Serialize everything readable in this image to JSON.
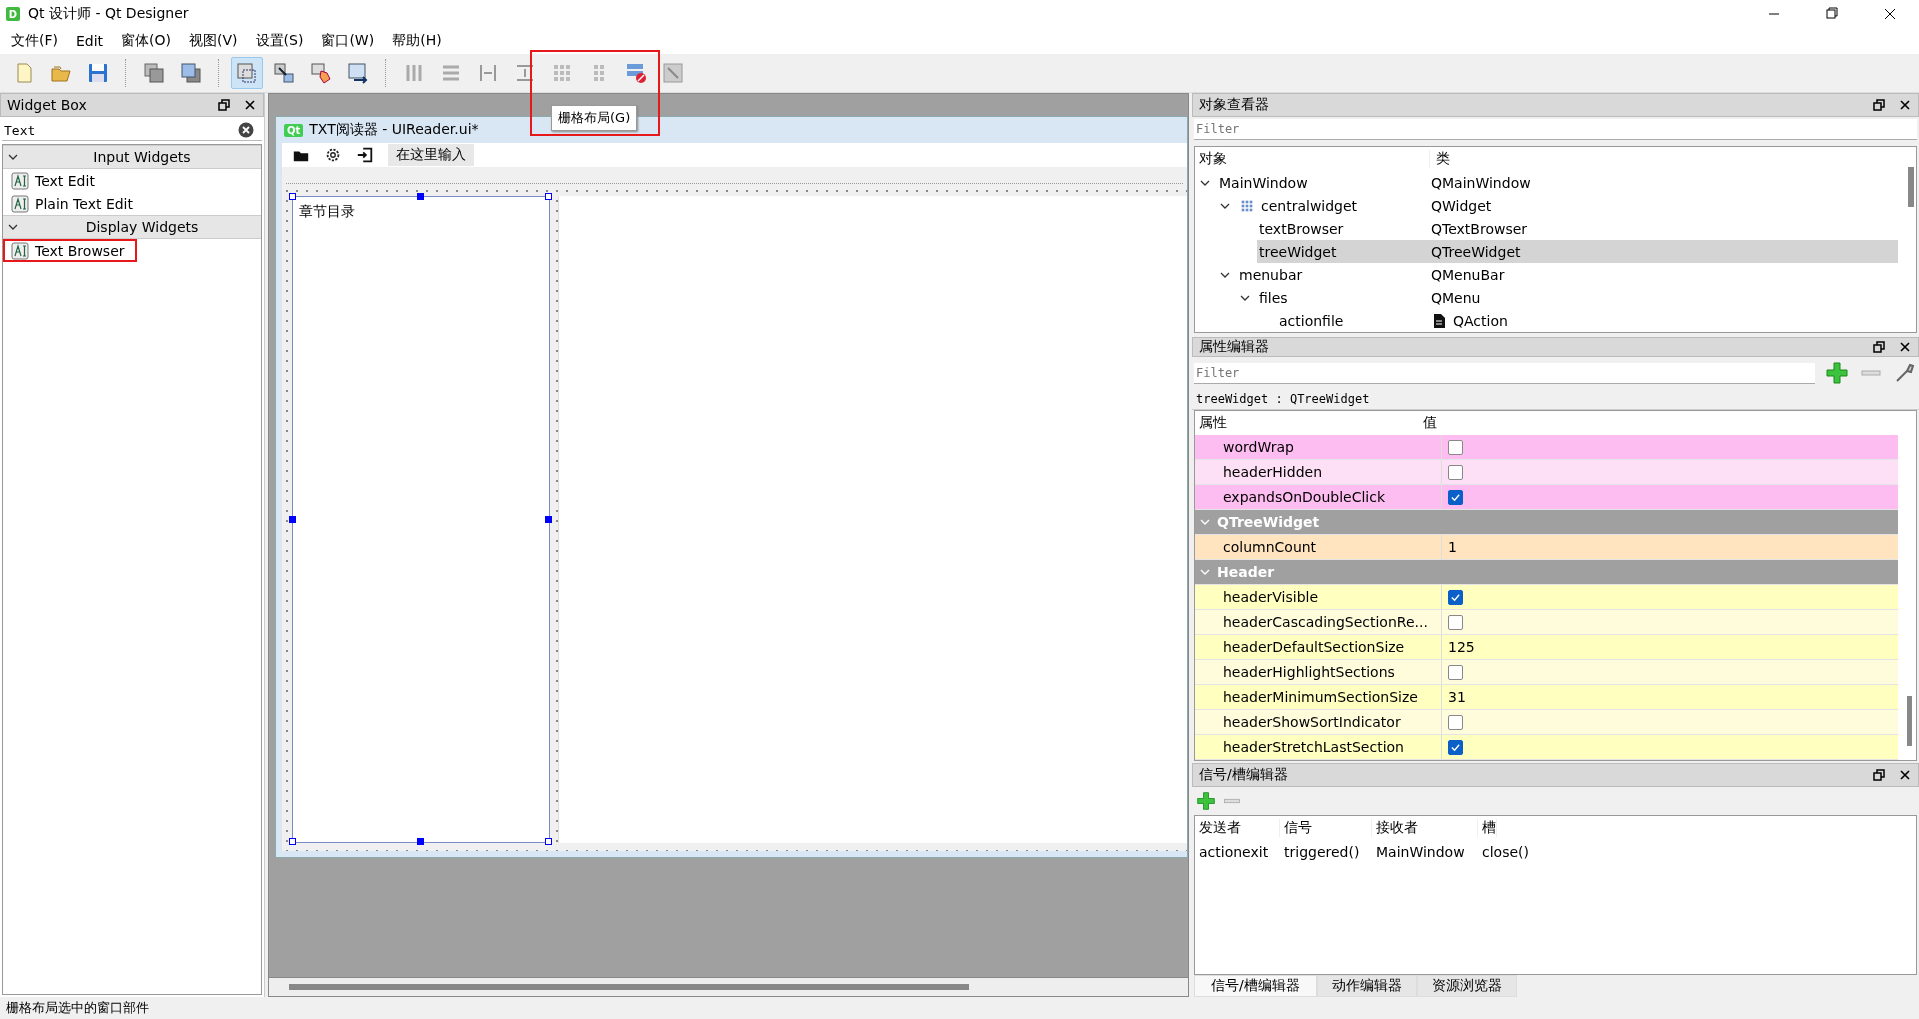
{
  "window": {
    "app_icon": "D",
    "title": "Qt 设计师 - Qt Designer"
  },
  "menu": [
    "文件(F)",
    "Edit",
    "窗体(O)",
    "视图(V)",
    "设置(S)",
    "窗口(W)",
    "帮助(H)"
  ],
  "tooltip": {
    "text": "栅格布局(G)",
    "highlighted": true
  },
  "widget_box": {
    "title": "Widget Box",
    "search": "Text",
    "categories": [
      {
        "name": "Input Widgets",
        "expanded": true,
        "items": [
          {
            "name": "Text Edit",
            "highlighted": false
          },
          {
            "name": "Plain Text Edit",
            "highlighted": false
          }
        ]
      },
      {
        "name": "Display Widgets",
        "expanded": true,
        "items": [
          {
            "name": "Text Browser",
            "highlighted": true
          }
        ]
      }
    ]
  },
  "form": {
    "logo": "Qt",
    "title": "TXT阅读器 - UIReader.ui*",
    "menu_placeholder": "在这里输入",
    "tree_header": "章节目录",
    "tree_selected": true
  },
  "object_inspector": {
    "title": "对象查看器",
    "filter_placeholder": "Filter",
    "columns": [
      "对象",
      "类"
    ],
    "tree": [
      {
        "name": "MainWindow",
        "class": "QMainWindow",
        "expanded": true,
        "selected": false,
        "children": [
          {
            "kind": "layout",
            "name": "centralwidget",
            "class": "QWidget",
            "expanded": true,
            "selected": false,
            "children": [
              {
                "name": "textBrowser",
                "class": "QTextBrowser",
                "selected": false
              },
              {
                "name": "treeWidget",
                "class": "QTreeWidget",
                "selected": true
              }
            ]
          },
          {
            "name": "menubar",
            "class": "QMenuBar",
            "expanded": true,
            "selected": false,
            "children": [
              {
                "name": "files",
                "class": "QMenu",
                "expanded": true,
                "selected": false,
                "children": [
                  {
                    "kind": "action",
                    "name": "actionfile",
                    "class": "QAction",
                    "selected": false
                  }
                ]
              }
            ]
          }
        ]
      }
    ]
  },
  "property_editor": {
    "title": "属性编辑器",
    "filter_placeholder": "Filter",
    "object_label": "treeWidget : QTreeWidget",
    "columns": [
      "属性",
      "值"
    ],
    "rows": [
      {
        "kind": "bool",
        "name": "wordWrap",
        "checked": false,
        "color": "#fdbdf0"
      },
      {
        "kind": "bool",
        "name": "headerHidden",
        "checked": false,
        "color": "#fde0f5"
      },
      {
        "kind": "bool",
        "name": "expandsOnDoubleClick",
        "checked": true,
        "color": "#fdbdf0"
      },
      {
        "kind": "group",
        "name": "QTreeWidget",
        "expanded": true
      },
      {
        "kind": "text",
        "name": "columnCount",
        "value": "1",
        "color": "#ffe4bf"
      },
      {
        "kind": "group",
        "name": "Header",
        "expanded": true
      },
      {
        "kind": "bool",
        "name": "headerVisible",
        "checked": true,
        "color": "#ffffc0"
      },
      {
        "kind": "bool",
        "name": "headerCascadingSectionRe...",
        "checked": false,
        "color": "#fffcdc"
      },
      {
        "kind": "text",
        "name": "headerDefaultSectionSize",
        "value": "125",
        "color": "#ffffc0"
      },
      {
        "kind": "bool",
        "name": "headerHighlightSections",
        "checked": false,
        "color": "#fffcdc"
      },
      {
        "kind": "text",
        "name": "headerMinimumSectionSize",
        "value": "31",
        "color": "#ffffc0"
      },
      {
        "kind": "bool",
        "name": "headerShowSortIndicator",
        "checked": false,
        "color": "#fffcdc"
      },
      {
        "kind": "bool",
        "name": "headerStretchLastSection",
        "checked": true,
        "color": "#ffffc0"
      }
    ]
  },
  "signal_slot_editor": {
    "title": "信号/槽编辑器",
    "columns": [
      "发送者",
      "信号",
      "接收者",
      "槽"
    ],
    "rows": [
      [
        "actionexit",
        "triggered()",
        "MainWindow",
        "close()"
      ]
    ]
  },
  "bottom_tabs": [
    {
      "label": "信号/槽编辑器",
      "selected": true
    },
    {
      "label": "动作编辑器",
      "selected": false
    },
    {
      "label": "资源浏览器",
      "selected": false
    }
  ],
  "status_bar": "栅格布局选中的窗口部件"
}
